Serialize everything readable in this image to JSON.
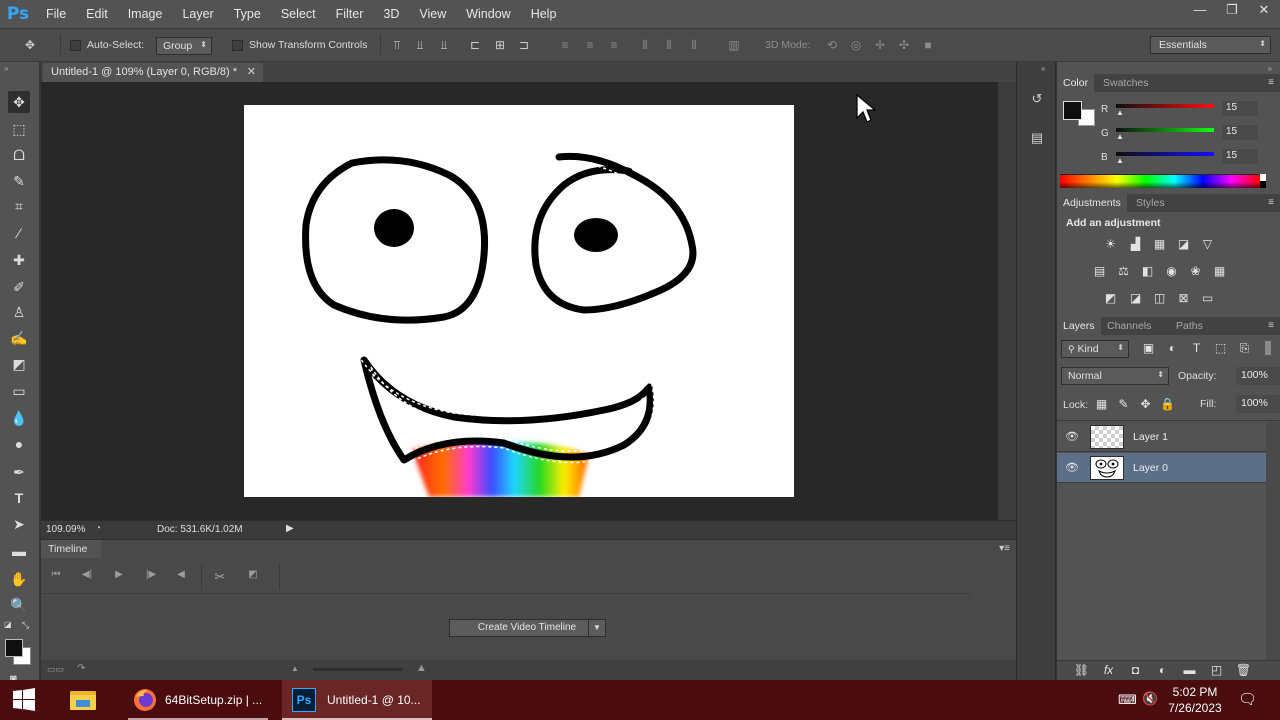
{
  "app": {
    "logo": "Ps",
    "name": "Adobe Photoshop"
  },
  "menu": [
    "File",
    "Edit",
    "Image",
    "Layer",
    "Type",
    "Select",
    "Filter",
    "3D",
    "View",
    "Window",
    "Help"
  ],
  "window_controls": {
    "minimize": "—",
    "restore": "❐",
    "close": "✕"
  },
  "options_bar": {
    "auto_select_label": "Auto-Select:",
    "auto_select_value": "Group",
    "show_transform_label": "Show Transform Controls",
    "mode3d_label": "3D Mode:",
    "workspace": "Essentials"
  },
  "document": {
    "tab_title": "Untitled-1 @ 109% (Layer 0, RGB/8) *",
    "zoom": "109.09%",
    "doc_info": "Doc: 531.6K/1.02M"
  },
  "timeline": {
    "tab": "Timeline",
    "create_button": "Create Video Timeline"
  },
  "color_panel": {
    "tabs": [
      "Color",
      "Swatches"
    ],
    "sliders": [
      {
        "label": "R",
        "value": "15"
      },
      {
        "label": "G",
        "value": "15"
      },
      {
        "label": "B",
        "value": "15"
      }
    ],
    "foreground": "#0f0f0f",
    "background": "#ffffff"
  },
  "adjustments_panel": {
    "tabs": [
      "Adjustments",
      "Styles"
    ],
    "heading": "Add an adjustment"
  },
  "layers_panel": {
    "tabs": [
      "Layers",
      "Channels",
      "Paths"
    ],
    "filter_kind": "Kind",
    "blend_mode": "Normal",
    "opacity_label": "Opacity:",
    "opacity_value": "100%",
    "lock_label": "Lock:",
    "fill_label": "Fill:",
    "fill_value": "100%",
    "layers": [
      {
        "name": "Layer 1",
        "visible": true,
        "selected": false
      },
      {
        "name": "Layer 0",
        "visible": true,
        "selected": true
      }
    ]
  },
  "taskbar": {
    "tasks": [
      {
        "label": "64BitSetup.zip | ...",
        "icon": "firefox-icon"
      },
      {
        "label": "Untitled-1 @ 10...",
        "icon": "photoshop-icon"
      }
    ],
    "time": "5:02 PM",
    "date": "7/26/2023"
  }
}
